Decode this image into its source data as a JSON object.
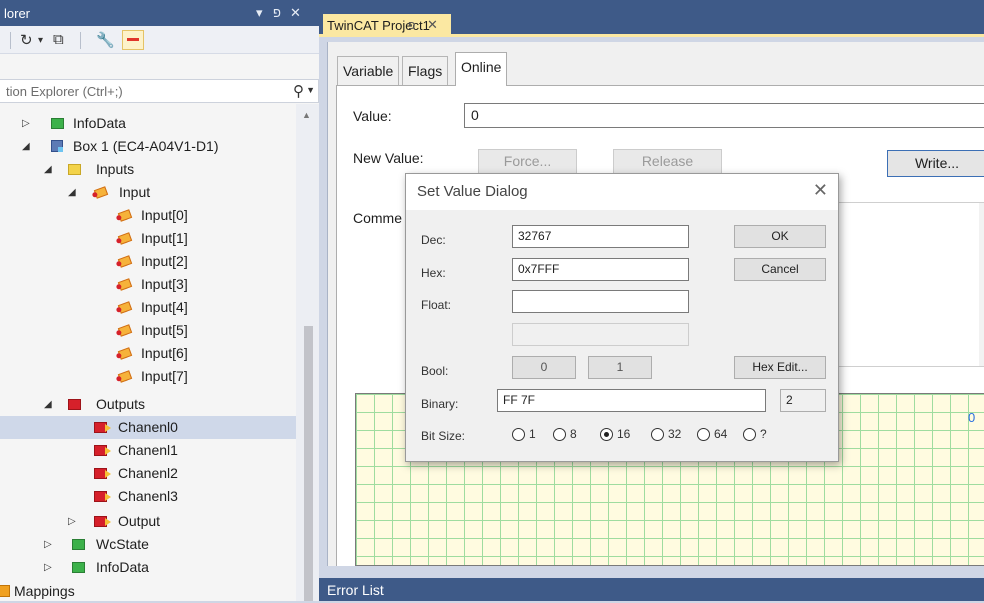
{
  "explorer": {
    "title": "lorer",
    "pin_glyph": "▾ \u0000",
    "search_placeholder": "tion Explorer (Ctrl+;)",
    "tree": [
      {
        "label": "InfoData",
        "icon": "green-io-icon",
        "expander": "▷"
      },
      {
        "label": "Box 1 (EC4-A04V1-D1)",
        "icon": "box-icon",
        "expander": "◢"
      },
      {
        "label": "Inputs",
        "icon": "yellow-folder-icon",
        "expander": "◢"
      },
      {
        "label": "Input",
        "icon": "input-var-icon",
        "expander": "◢"
      },
      {
        "label": "Input[0]",
        "icon": "input-var-icon"
      },
      {
        "label": "Input[1]",
        "icon": "input-var-icon"
      },
      {
        "label": "Input[2]",
        "icon": "input-var-icon"
      },
      {
        "label": "Input[3]",
        "icon": "input-var-icon"
      },
      {
        "label": "Input[4]",
        "icon": "input-var-icon"
      },
      {
        "label": "Input[5]",
        "icon": "input-var-icon"
      },
      {
        "label": "Input[6]",
        "icon": "input-var-icon"
      },
      {
        "label": "Input[7]",
        "icon": "input-var-icon"
      },
      {
        "label": "Outputs",
        "icon": "red-folder-icon",
        "expander": "◢"
      },
      {
        "label": "Chanenl0",
        "icon": "output-var-icon",
        "selected": true
      },
      {
        "label": "Chanenl1",
        "icon": "output-var-icon"
      },
      {
        "label": "Chanenl2",
        "icon": "output-var-icon"
      },
      {
        "label": "Chanenl3",
        "icon": "output-var-icon"
      },
      {
        "label": "Output",
        "icon": "output-var-icon",
        "expander": "▷"
      },
      {
        "label": "WcState",
        "icon": "green-io-icon",
        "expander": "▷"
      },
      {
        "label": "InfoData",
        "icon": "green-io-icon",
        "expander": "▷"
      },
      {
        "label": "Mappings",
        "icon": "mappings-icon"
      }
    ]
  },
  "document": {
    "tab_title": "TwinCAT Project1",
    "tabs": [
      "Variable",
      "Flags",
      "Online"
    ],
    "active_tab": "Online",
    "value_label": "Value:",
    "value": "0",
    "new_value_label": "New Value:",
    "force_label": "Force...",
    "release_label": "Release",
    "write_label": "Write...",
    "comment_label": "Comme",
    "grid_value": "0",
    "error_list_label": "Error List"
  },
  "dialog": {
    "title": "Set Value Dialog",
    "dec_label": "Dec:",
    "dec_value": "32767",
    "hex_label": "Hex:",
    "hex_value": "0x7FFF",
    "float_label": "Float:",
    "float_value": "",
    "bool_label": "Bool:",
    "bool_0": "0",
    "bool_1": "1",
    "binary_label": "Binary:",
    "binary_value": "FF 7F",
    "binary_count": "2",
    "bitsize_label": "Bit Size:",
    "ok_label": "OK",
    "cancel_label": "Cancel",
    "hexedit_label": "Hex Edit...",
    "bit_sizes": [
      "1",
      "8",
      "16",
      "32",
      "64",
      "?"
    ],
    "selected_bit_size": "16"
  }
}
